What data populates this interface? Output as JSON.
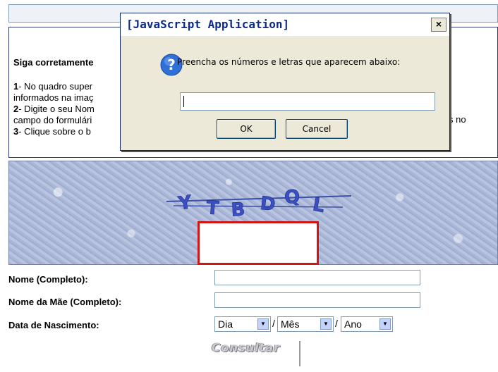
{
  "instructions": {
    "heading": "Siga corretamente",
    "line1_num": "1",
    "line1_text": "- No quadro super",
    "line2_text": "informados na imaç",
    "line3_num": "2",
    "line3_text": "- Digite o seu Nom",
    "line3_tail": "s no",
    "line4_text": "campo do formulári",
    "line5_num": "3",
    "line5_text": "- Clique sobre o b"
  },
  "captcha": {
    "text": "YTBDQL"
  },
  "form": {
    "nome_label": "Nome (Completo):",
    "mae_label": "Nome da Mãe (Completo):",
    "nasc_label": "Data de Nascimento:",
    "dia": "Dia",
    "mes": "Mês",
    "ano": "Ano",
    "slash": "/",
    "submit": "Consultar"
  },
  "dialog": {
    "title": "[JavaScript Application]",
    "close": "×",
    "message": "Preencha os números e letras que aparecem abaixo:",
    "input_value": "",
    "ok": "OK",
    "cancel": "Cancel"
  }
}
